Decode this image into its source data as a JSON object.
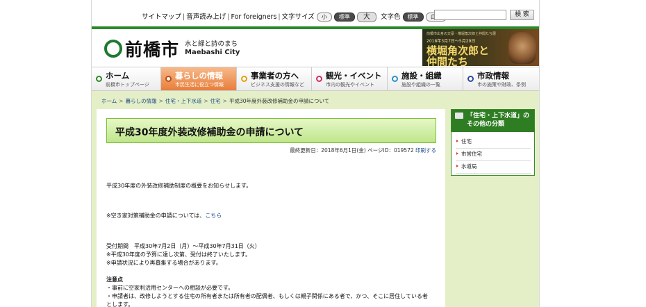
{
  "util": {
    "links": [
      "サイトマップ",
      "音声読み上げ",
      "For foreigners"
    ],
    "font_size_label": "文字サイズ",
    "font_size_options": [
      "小",
      "標準",
      "大"
    ],
    "color_label": "文字色",
    "color_options": [
      "標準",
      "白黒"
    ],
    "search_placeholder": "",
    "search_button": "検 索"
  },
  "header": {
    "logo_name": "前橋市",
    "logo_tagline": "水と緑と詩のまち",
    "logo_roman": "Maebashi City",
    "banner_small": "前橋市出身の文豪・横堀角次郎と仲間たち展",
    "banner_date": "2018年3月7日〜5月29日",
    "banner_title_1": "横堀角次郎と",
    "banner_title_2": "仲間たち"
  },
  "gnav": [
    {
      "label": "ホーム",
      "desc": "前橋市トップページ",
      "color": "#2b8a2b"
    },
    {
      "label": "暮らしの情報",
      "desc": "市民生活に役立つ情報",
      "color": "#e06a1a",
      "active": true
    },
    {
      "label": "事業者の方へ",
      "desc": "ビジネス支援の情報など",
      "color": "#e0a010"
    },
    {
      "label": "観光・イベント",
      "desc": "市内の観光やイベント",
      "color": "#d0305a"
    },
    {
      "label": "施設・組織",
      "desc": "施設や組織の一覧",
      "color": "#2a90c8"
    },
    {
      "label": "市政情報",
      "desc": "市の施策や財政、条例",
      "color": "#2a4aa0"
    }
  ],
  "breadcrumb": [
    "ホーム",
    "暮らしの情報",
    "住宅・上下水道",
    "住宅",
    "平成30年度外装改修補助金の申請について"
  ],
  "page": {
    "title": "平成30年度外装改修補助金の申請について",
    "updated": "最終更新日：2018年6月1日(金)",
    "page_id": "ページID：019572",
    "print": "印刷する",
    "intro": "平成30年度の外装改修補助制度の概要をお知らせします。",
    "akiya_note": "※空き家対策補助金の申請については、",
    "akiya_link": "こちら",
    "period": "受付期間　平成30年7月2日（月）～平成30年7月31日（火）",
    "note1": "※平成30年度の予算に達し次第、受付は終了いたします。",
    "note2": "※申請状況により再募集する場合があります。",
    "caution_head": "注意点",
    "caution1": "・事前に空家利活用センターへの相談が必要です。",
    "caution2": "・申請者は、改修しようとする住宅の所有者または所有者の配偶者、もしくは親子関係にある者で、かつ、そこに居住している者",
    "caution3": "とします。"
  },
  "side": {
    "title": "「住宅・上下水道」のその他の分類",
    "items": [
      "住宅",
      "市営住宅",
      "水道局"
    ]
  },
  "colors": {
    "brand_green": "#2f7d22",
    "band": "#e4efc7",
    "link": "#1a4a8a",
    "active_tab": "#e87e3a"
  }
}
